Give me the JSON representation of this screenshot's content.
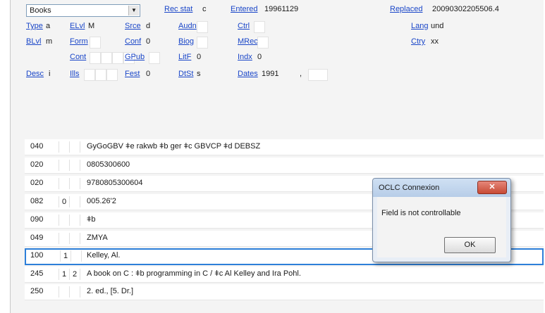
{
  "record_type": {
    "selected": "Books"
  },
  "header": [
    {
      "key": "recstat",
      "label": "Rec stat",
      "value": "c"
    },
    {
      "key": "entered",
      "label": "Entered",
      "value": "19961129"
    },
    {
      "key": "replaced",
      "label": "Replaced",
      "value": "20090302205506.4"
    }
  ],
  "fixed_fields": [
    {
      "key": "type",
      "label": "Type",
      "value": "a"
    },
    {
      "key": "elvl",
      "label": "ELvl",
      "value": "M"
    },
    {
      "key": "srce",
      "label": "Srce",
      "value": "d"
    },
    {
      "key": "audn",
      "label": "Audn",
      "value": ""
    },
    {
      "key": "ctrl",
      "label": "Ctrl",
      "value": ""
    },
    {
      "key": "lang",
      "label": "Lang",
      "value": "und"
    },
    {
      "key": "blvl",
      "label": "BLvl",
      "value": "m"
    },
    {
      "key": "form",
      "label": "Form",
      "value": ""
    },
    {
      "key": "conf",
      "label": "Conf",
      "value": "0"
    },
    {
      "key": "biog",
      "label": "Biog",
      "value": ""
    },
    {
      "key": "mrec",
      "label": "MRec",
      "value": ""
    },
    {
      "key": "ctry",
      "label": "Ctry",
      "value": "xx"
    },
    {
      "key": "cont",
      "label": "Cont",
      "value": ""
    },
    {
      "key": "gpub",
      "label": "GPub",
      "value": ""
    },
    {
      "key": "litf",
      "label": "LitF",
      "value": "0"
    },
    {
      "key": "indx",
      "label": "Indx",
      "value": "0"
    },
    {
      "key": "desc",
      "label": "Desc",
      "value": "i"
    },
    {
      "key": "ills",
      "label": "Ills",
      "value": ""
    },
    {
      "key": "fest",
      "label": "Fest",
      "value": "0"
    },
    {
      "key": "dtst",
      "label": "DtSt",
      "value": "s"
    },
    {
      "key": "dates",
      "label": "Dates",
      "value": "1991",
      "value2": ","
    }
  ],
  "variable_fields": [
    {
      "tag": "040",
      "ind1": "",
      "ind2": "",
      "data": "GyGoGBV ǂe rakwb ǂb ger ǂc GBVCP ǂd DEBSZ"
    },
    {
      "tag": "020",
      "ind1": "",
      "ind2": "",
      "data": "0805300600"
    },
    {
      "tag": "020",
      "ind1": "",
      "ind2": "",
      "data": "9780805300604"
    },
    {
      "tag": "082",
      "ind1": "0",
      "ind2": "",
      "data": "005.26'2"
    },
    {
      "tag": "090",
      "ind1": "",
      "ind2": "",
      "data": "ǂb"
    },
    {
      "tag": "049",
      "ind1": "",
      "ind2": "",
      "data": "ZMYA"
    },
    {
      "tag": "100",
      "ind1": "1",
      "ind2": "",
      "data": "Kelley, Al."
    },
    {
      "tag": "245",
      "ind1": "1",
      "ind2": "2",
      "data": "A book on C : ǂb programming in C / ǂc Al Kelley and Ira Pohl."
    },
    {
      "tag": "250",
      "ind1": "",
      "ind2": "",
      "data": "2. ed., [5. Dr.]"
    }
  ],
  "dialog": {
    "title": "OCLC Connexion",
    "close_glyph": "✕",
    "message": "Field is not controllable",
    "ok_label": "OK"
  }
}
